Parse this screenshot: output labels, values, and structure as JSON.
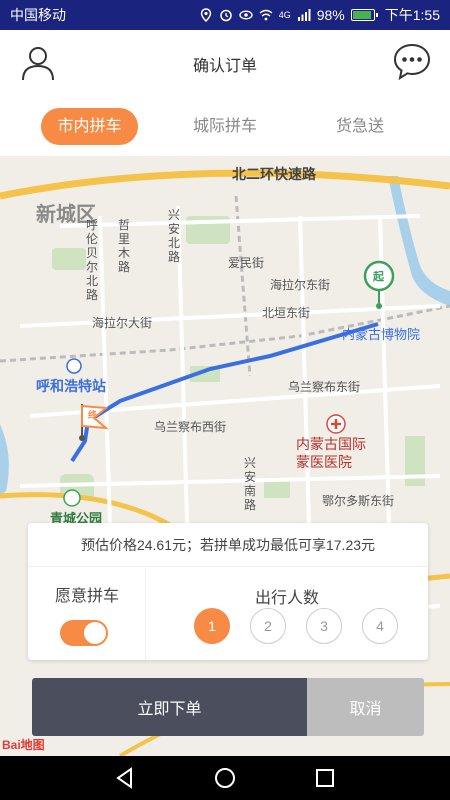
{
  "status_bar": {
    "carrier": "中国移动",
    "battery": "98%",
    "battery_level": 0.98,
    "time": "下午1:55",
    "network": "4G"
  },
  "header": {
    "title": "确认订单"
  },
  "tabs": [
    {
      "label": "市内拼车",
      "active": true
    },
    {
      "label": "城际拼车",
      "active": false
    },
    {
      "label": "货急送",
      "active": false
    }
  ],
  "map": {
    "labels": {
      "xincheng": "新城区",
      "ring": "北二环快速路",
      "hulunbeier": "呼伦贝尔北路",
      "zhelimu": "哲里木路",
      "xingan_n": "兴安北路",
      "aimin": "爱民街",
      "hailaer_e": "海拉尔东街",
      "hailaer_w": "海拉尔大街",
      "beiyuan": "北垣东街",
      "museum": "内蒙古博物院",
      "hohhot_station": "呼和浩特站",
      "wulanchabu_e": "乌兰察布东街",
      "wulanchabu_w": "乌兰察布西街",
      "hospital": "内蒙古国际蒙医医院",
      "xingan_s": "兴安南路",
      "eerduosi": "鄂尔多斯东街",
      "qingcheng": "青城公园",
      "start_marker": "起",
      "end_marker": "终",
      "baidu": "Bai地图"
    },
    "route_color": "#3a6fe0"
  },
  "order_panel": {
    "price_text": "预估价格24.61元；若拼单成功最低可享17.23元",
    "carpool_label": "愿意拼车",
    "carpool_enabled": true,
    "passengers_title": "出行人数",
    "passenger_options": [
      "1",
      "2",
      "3",
      "4"
    ],
    "selected_passengers": "1"
  },
  "actions": {
    "order_label": "立即下单",
    "cancel_label": "取消"
  },
  "colors": {
    "accent": "#f78a44",
    "status_bar": "#1a237e",
    "order_button": "#4a4e5d",
    "cancel_button": "#bdbdbd"
  }
}
